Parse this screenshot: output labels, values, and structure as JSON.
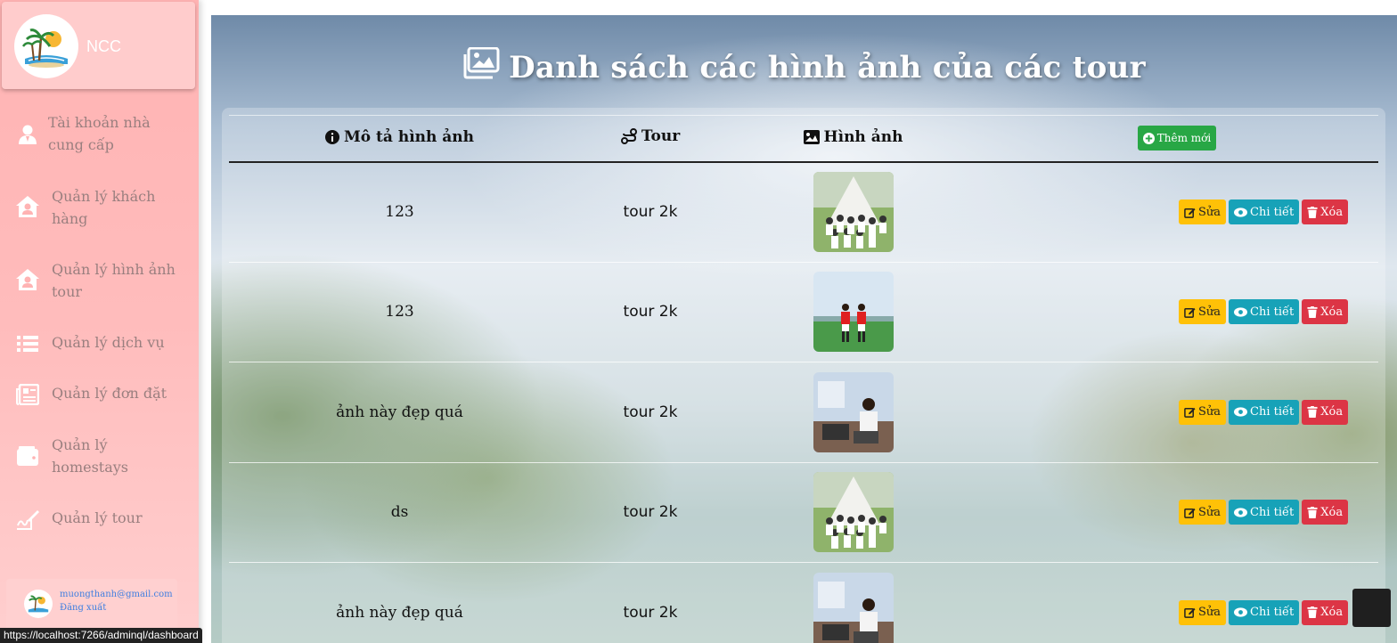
{
  "brand": {
    "name": "NCC"
  },
  "sidebar": {
    "items": [
      {
        "label": "Tài khoản nhà cung cấp",
        "icon": "user-icon"
      },
      {
        "label": "Quản lý khách hàng",
        "icon": "house-user-icon"
      },
      {
        "label": "Quản lý hình ảnh tour",
        "icon": "house-user-icon"
      },
      {
        "label": "Quản lý dịch vụ",
        "icon": "list-icon"
      },
      {
        "label": "Quản lý đơn đặt",
        "icon": "newspaper-icon"
      },
      {
        "label": "Quản lý homestays",
        "icon": "wallet-icon"
      },
      {
        "label": "Quản lý tour",
        "icon": "signature-icon"
      }
    ]
  },
  "user": {
    "email": "muongthanh@gmail.com",
    "logout": "Đăng xuất"
  },
  "status_url": "https://localhost:7266/adminql/dashboard",
  "page": {
    "title": "Danh sách các hình ảnh của các tour"
  },
  "table": {
    "headers": {
      "desc": "Mô tả hình ảnh",
      "tour": "Tour",
      "image": "Hình ảnh",
      "add": "Thêm mới"
    },
    "actions": {
      "edit": "Sửa",
      "detail": "Chi tiết",
      "delete": "Xóa"
    },
    "rows": [
      {
        "desc": "123",
        "tour": "tour 2k",
        "image": "group-photo"
      },
      {
        "desc": "123",
        "tour": "tour 2k",
        "image": "football-photo"
      },
      {
        "desc": "ảnh này đẹp quá",
        "tour": "tour 2k",
        "image": "office-photo"
      },
      {
        "desc": "ds",
        "tour": "tour 2k",
        "image": "group-photo"
      },
      {
        "desc": "ảnh này đẹp quá",
        "tour": "tour 2k",
        "image": "office-photo"
      }
    ]
  },
  "colors": {
    "sidebar": "#ffb3b3",
    "add": "#28a745",
    "edit": "#ffc107",
    "detail": "#17a2b8",
    "delete": "#dc3545"
  }
}
